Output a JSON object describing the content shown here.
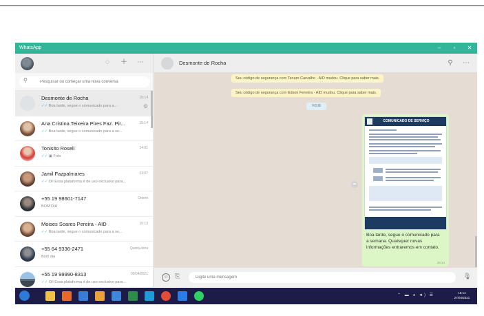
{
  "window": {
    "title": "WhatsApp"
  },
  "sidebar": {
    "search_placeholder": "Pesquisar ou começar uma nova conversa",
    "chats": [
      {
        "name": "Desmonte de Rocha",
        "time": "15:14",
        "preview": "Boa tarde, segue o comunicado para a...",
        "read": true,
        "active": true,
        "pinned": true,
        "avatar": "default"
      },
      {
        "name": "Ana Cristina Teixeira Pires Faz. Pir...",
        "time": "15:14",
        "preview": "Boa tarde, segue o comunicado para a se...",
        "read": true,
        "avatar": "photo"
      },
      {
        "name": "Tonisito Roseli",
        "time": "14:01",
        "preview": "Foto",
        "read": true,
        "avatar": "photo-red"
      },
      {
        "name": "Jamil Fazpalmares",
        "time": "13:07",
        "preview": "Oi! Essa plataforma é de uso exclusivo para...",
        "read": true,
        "avatar": "photo"
      },
      {
        "name": "+55 19 98601-7147",
        "time": "Ontem",
        "preview": "BOM DIA",
        "read": false,
        "avatar": "photo-dark"
      },
      {
        "name": "Moises Soares Pereira - AID",
        "time": "15:13",
        "preview": "Boa tarde, segue o comunicado para a se...",
        "read": true,
        "avatar": "photo"
      },
      {
        "name": "+55 64 9336-2471",
        "time": "Quinta-feira",
        "preview": "Bom dia",
        "read": false,
        "avatar": "photo-dark"
      },
      {
        "name": "+55 19 99990-8313",
        "time": "09/04/2021",
        "preview": "Oi! Essa plataforma é de uso exclusivo para...",
        "read": true,
        "avatar": "photo-road"
      }
    ]
  },
  "chat": {
    "contact_name": "Desmonte de Rocha",
    "notices": [
      "Seu código de segurança com Tenaro Carvalho - AID mudou. Clique para saber mais.",
      "Seu código de segurança com Edson Ferreira - AID mudou. Clique para saber mais."
    ],
    "date_label": "HOJE",
    "card_title": "COMUNICADO DE SERVIÇO",
    "message_text": "Boa tarde, segue o comunicado para a semana. Quaisquer novas informações entraremos em contato.",
    "message_time": "15:14",
    "compose_placeholder": "Digite uma mensagem"
  },
  "taskbar": {
    "time": "15:14",
    "date": "27/04/2021"
  },
  "colors": {
    "titlebar": "#33b59a",
    "chat_background": "#e5ddd4",
    "outgoing_bubble": "#dcf6c6",
    "notice": "#fcf4c7",
    "taskbar": "#1d1b47",
    "read_tick": "#4fb6ec"
  },
  "icons": [
    "status-icon",
    "new-chat-icon",
    "menu-icon",
    "search-icon",
    "emoji-icon",
    "attach-icon",
    "mic-icon",
    "pin-icon",
    "windows-start-icon"
  ]
}
